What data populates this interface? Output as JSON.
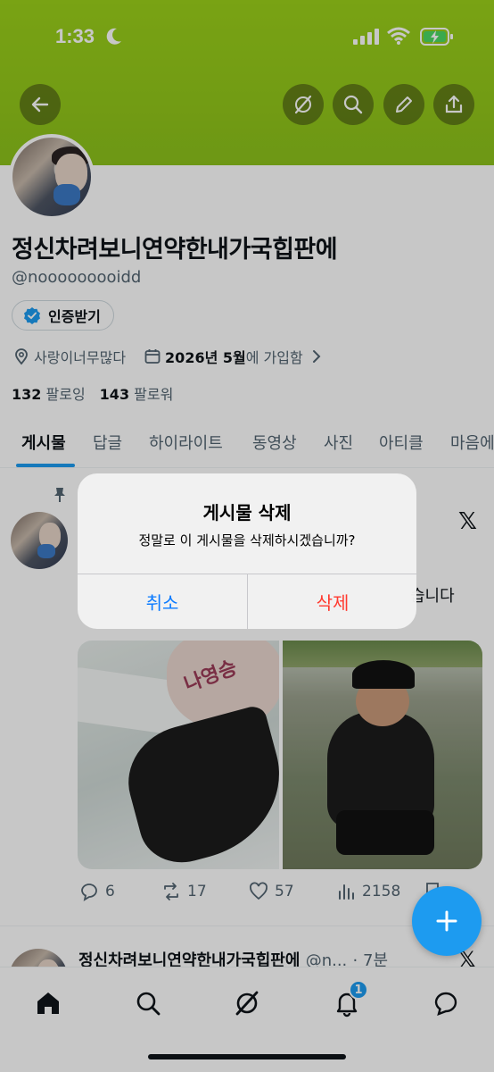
{
  "status_bar": {
    "time": "1:33"
  },
  "profile": {
    "name": "정신차려보니연약한내가국힙판에",
    "handle": "@nooooooooidd",
    "verify_label": "인증받기",
    "location": "사랑이너무많다",
    "joined_strong": "2026년 5월",
    "joined_suffix": "에 가입함",
    "following_count": "132",
    "following_label": "팔로잉",
    "followers_count": "143",
    "followers_label": "팔로워"
  },
  "tabs": [
    "게시물",
    "답글",
    "하이라이트",
    "동영상",
    "사진",
    "아티클",
    "마음에"
  ],
  "post1": {
    "text_fragment": "습니다",
    "image1_ink": "나영승",
    "replies": "6",
    "reposts": "17",
    "likes": "57",
    "views": "2158"
  },
  "post2": {
    "name": "정신차려보니연약한내가국힙판에",
    "handle": "@n...",
    "time": "· 7분"
  },
  "dialog": {
    "title": "게시물 삭제",
    "message": "정말로 이 게시물을 삭제하시겠습니까?",
    "cancel": "취소",
    "delete": "삭제"
  },
  "bottom_nav": {
    "notification_badge": "1"
  },
  "icons": {
    "back": "arrow-left-icon",
    "grok": "grok-icon",
    "search": "search-icon",
    "edit": "pencil-icon",
    "share": "share-icon",
    "home": "home-icon",
    "notifications": "bell-icon",
    "messages": "message-icon",
    "compose": "plus-icon"
  },
  "colors": {
    "banner": "#93c81a",
    "accent": "#1d9bf0",
    "delete": "#ff3b30",
    "cancel": "#0a7aff"
  }
}
